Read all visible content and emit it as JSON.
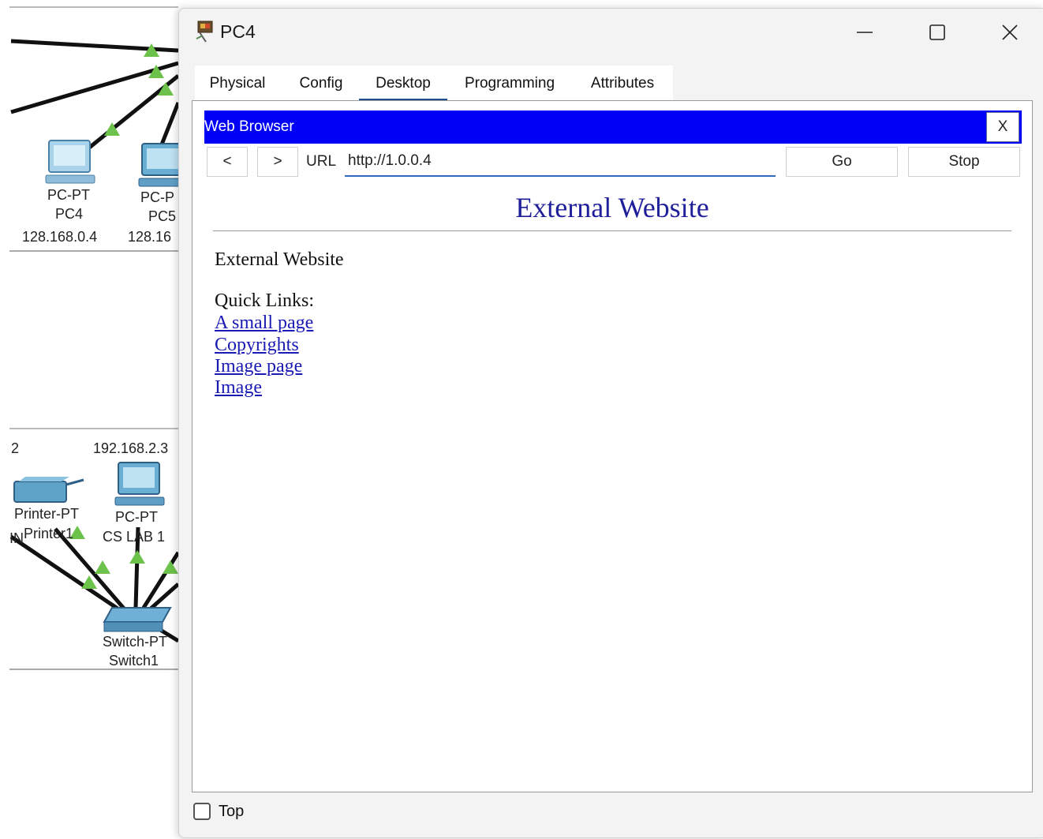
{
  "workspace": {
    "devices": [
      {
        "type": "PC-PT",
        "name": "PC4",
        "ip": "128.168.0.4"
      },
      {
        "type": "PC-P",
        "name": "PC5",
        "ip": "128.16"
      },
      {
        "type": "Printer-PT",
        "name": "Printer1"
      },
      {
        "type": "PC-PT",
        "name": "CS LAB 1"
      },
      {
        "type": "Switch-PT",
        "name": "Switch1"
      }
    ],
    "ip_left": "2",
    "ip_pc": "192.168.2.3",
    "stray_label": "IN"
  },
  "window": {
    "title": "PC4",
    "minimize_glyph": "—",
    "maximize_glyph": "☐",
    "close_glyph": "✕",
    "icon": "packet-tracer-pc-icon",
    "tabs": [
      {
        "label": "Physical",
        "active": false
      },
      {
        "label": "Config",
        "active": false
      },
      {
        "label": "Desktop",
        "active": true
      },
      {
        "label": "Programming",
        "active": false
      },
      {
        "label": "Attributes",
        "active": false
      }
    ]
  },
  "browser": {
    "title": "Web Browser",
    "close_label": "X",
    "back_label": "<",
    "forward_label": ">",
    "url_label": "URL",
    "url_value": "http://1.0.0.4",
    "go_label": "Go",
    "stop_label": "Stop",
    "header_color": "#0000f6"
  },
  "page": {
    "heading": "External Website",
    "body_text": "External Website",
    "quick_links_label": "Quick Links:",
    "links": [
      "A small page",
      "Copyrights",
      "Image page",
      "Image"
    ]
  },
  "footer": {
    "top_label": "Top",
    "top_checked": false
  }
}
